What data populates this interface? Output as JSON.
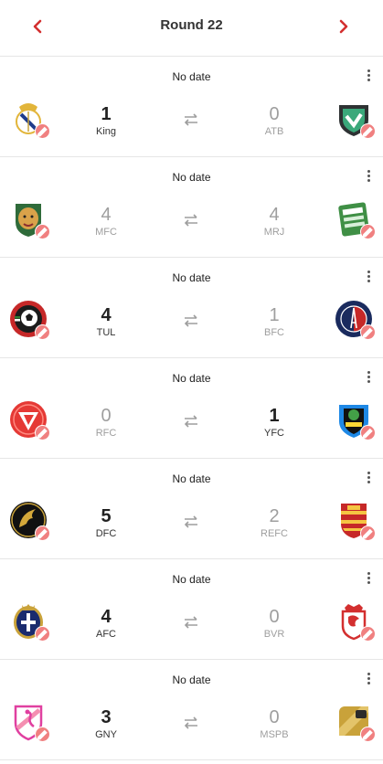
{
  "header": {
    "title": "Round 22",
    "prev_icon": "chevron-left-icon",
    "next_icon": "chevron-right-icon",
    "accent": "#d32f2f"
  },
  "colors": {
    "edit_badge": "#f08080",
    "winner_text": "#212121",
    "loser_text": "#9e9e9e"
  },
  "matches": [
    {
      "date": "No date",
      "home": {
        "score": "1",
        "abbr": "King",
        "logo": "real-madrid-crest-icon"
      },
      "away": {
        "score": "0",
        "abbr": "ATB",
        "logo": "atb-shield-icon"
      }
    },
    {
      "date": "No date",
      "home": {
        "score": "4",
        "abbr": "MFC",
        "logo": "jaguar-crest-icon"
      },
      "away": {
        "score": "4",
        "abbr": "MRJ",
        "logo": "green-badge-icon"
      }
    },
    {
      "date": "No date",
      "home": {
        "score": "4",
        "abbr": "TUL",
        "logo": "tul-soccer-ball-icon"
      },
      "away": {
        "score": "1",
        "abbr": "BFC",
        "logo": "bfc-eiffel-tower-icon"
      }
    },
    {
      "date": "No date",
      "home": {
        "score": "0",
        "abbr": "RFC",
        "logo": "rfc-triangle-icon"
      },
      "away": {
        "score": "1",
        "abbr": "YFC",
        "logo": "yfc-shield-icon"
      }
    },
    {
      "date": "No date",
      "home": {
        "score": "5",
        "abbr": "DFC",
        "logo": "dfc-eagle-icon"
      },
      "away": {
        "score": "2",
        "abbr": "REFC",
        "logo": "refc-striped-shield-icon"
      }
    },
    {
      "date": "No date",
      "home": {
        "score": "4",
        "abbr": "AFC",
        "logo": "afc-cross-crest-icon"
      },
      "away": {
        "score": "0",
        "abbr": "BVR",
        "logo": "bvr-red-crest-icon"
      }
    },
    {
      "date": "No date",
      "home": {
        "score": "3",
        "abbr": "GNY",
        "logo": "gny-flamingo-icon"
      },
      "away": {
        "score": "0",
        "abbr": "MSPB",
        "logo": "mspb-gold-badge-icon"
      }
    }
  ]
}
